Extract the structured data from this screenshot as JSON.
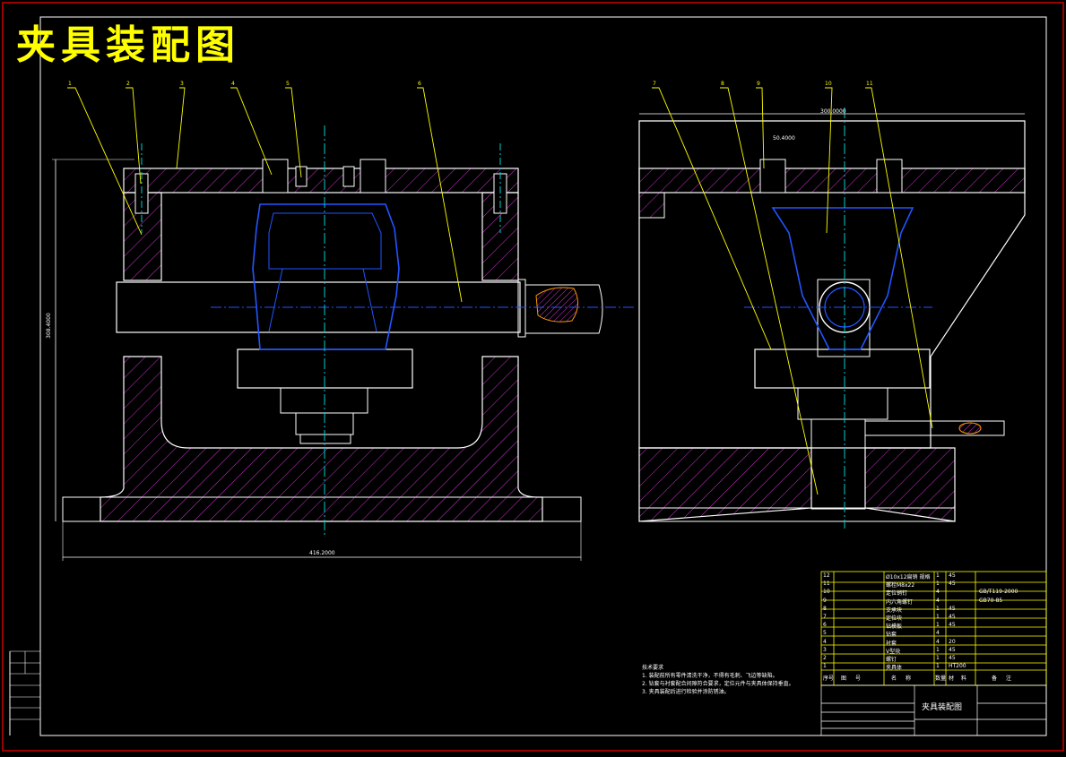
{
  "title": "夹具装配图",
  "drawing_name": "夹具装配图",
  "dimensions": {
    "overall_width": "416.2000",
    "overall_height": "308.4000",
    "right_top": "300.0000",
    "small_dim": "50.4000"
  },
  "left_view_callouts": [
    "1",
    "2",
    "3",
    "4",
    "5",
    "6"
  ],
  "right_view_callouts": [
    "7",
    "8",
    "9",
    "10",
    "11"
  ],
  "bom_header": {
    "seq": "序号",
    "code": "图号",
    "name": "名称",
    "qty": "数量",
    "material": "材料",
    "remark": "备注"
  },
  "bom_rows": [
    {
      "seq": "12",
      "name": "Ø10x12扁销 规格",
      "qty": "1",
      "material": "45",
      "remark": ""
    },
    {
      "seq": "11",
      "name": "螺栓M8x22",
      "qty": "1",
      "material": "45",
      "remark": ""
    },
    {
      "seq": "10",
      "name": "定位销钉",
      "qty": "4",
      "material": "",
      "remark": "GB/T119-2000"
    },
    {
      "seq": "9",
      "name": "内六角螺钉",
      "qty": "4",
      "material": "",
      "remark": "GB70-85"
    },
    {
      "seq": "8",
      "name": "支承块",
      "qty": "1",
      "material": "45",
      "remark": ""
    },
    {
      "seq": "7",
      "name": "定位块",
      "qty": "1",
      "material": "45",
      "remark": ""
    },
    {
      "seq": "6",
      "name": "钻模板",
      "qty": "1",
      "material": "45",
      "remark": ""
    },
    {
      "seq": "5",
      "name": "钻套",
      "qty": "4",
      "material": "",
      "remark": ""
    },
    {
      "seq": "4",
      "name": "衬套",
      "qty": "4",
      "material": "20",
      "remark": ""
    },
    {
      "seq": "3",
      "name": "V型块",
      "qty": "1",
      "material": "45",
      "remark": ""
    },
    {
      "seq": "2",
      "name": "螺钉",
      "qty": "1",
      "material": "45",
      "remark": ""
    },
    {
      "seq": "1",
      "name": "夹具体",
      "qty": "1",
      "material": "HT200",
      "remark": ""
    }
  ],
  "notes": {
    "heading": "技术要求",
    "lines": [
      "1. 装配前所有零件清洗干净，不得有毛刺、飞边等缺陷。",
      "2. 钻套与衬套配合间隙符合要求，定位元件与夹具体保持垂直。",
      "3. 夹具装配后进行检验并涂防锈油。"
    ]
  },
  "colors": {
    "outline": "#ffffff",
    "hatch": "#cc33cc",
    "workpiece": "#2255ff",
    "centerline": "#00cccc",
    "leader": "#ffff00",
    "border": "#cc0000",
    "accent": "#ff9900"
  }
}
